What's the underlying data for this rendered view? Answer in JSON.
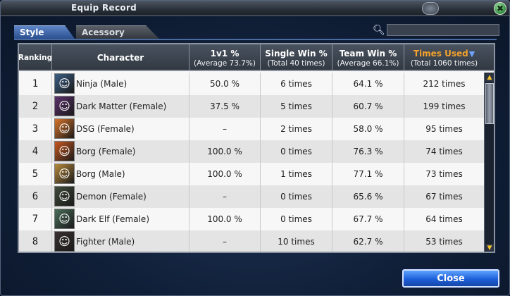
{
  "window": {
    "title": "Equip Record",
    "close_glyph": "✖"
  },
  "tabs": [
    {
      "label": "Style",
      "active": true
    },
    {
      "label": "Acessory",
      "active": false
    }
  ],
  "search": {
    "icon": "search-icon",
    "value": ""
  },
  "table": {
    "headers": {
      "ranking": "Ranking",
      "character": "Character",
      "v1": {
        "title": "1v1 %",
        "sub": "(Average 73.7%)"
      },
      "single": {
        "title": "Single Win %",
        "sub": "(Total 40 times)"
      },
      "team": {
        "title": "Team Win %",
        "sub": "(Average 66.1%)"
      },
      "times": {
        "title": "Times Used",
        "sub": "(Total 1060 times)"
      }
    },
    "sorted_column": "times",
    "rows": [
      {
        "rank": "1",
        "character": "Ninja (Male)",
        "v1": "50.0 %",
        "single": "6 times",
        "team": "64.1 %",
        "times": "212 times",
        "avatar_color": "#3b5f86",
        "avatar_icon": "ninja-portrait-icon"
      },
      {
        "rank": "2",
        "character": "Dark Matter (Female)",
        "v1": "37.5 %",
        "single": "5 times",
        "team": "60.7 %",
        "times": "199 times",
        "avatar_color": "#5b2f6b",
        "avatar_icon": "dark-matter-portrait-icon"
      },
      {
        "rank": "3",
        "character": "DSG (Female)",
        "v1": "–",
        "single": "2 times",
        "team": "58.0 %",
        "times": "95 times",
        "avatar_color": "#d9742a",
        "avatar_icon": "dsg-portrait-icon"
      },
      {
        "rank": "4",
        "character": "Borg (Female)",
        "v1": "100.0 %",
        "single": "0 times",
        "team": "76.3 %",
        "times": "74 times",
        "avatar_color": "#c8581f",
        "avatar_icon": "borg-female-portrait-icon"
      },
      {
        "rank": "5",
        "character": "Borg (Male)",
        "v1": "100.0 %",
        "single": "1 times",
        "team": "77.1 %",
        "times": "73 times",
        "avatar_color": "#b78a3c",
        "avatar_icon": "borg-male-portrait-icon"
      },
      {
        "rank": "6",
        "character": "Demon (Female)",
        "v1": "–",
        "single": "0 times",
        "team": "65.6 %",
        "times": "67 times",
        "avatar_color": "#3f4a3a",
        "avatar_icon": "demon-portrait-icon"
      },
      {
        "rank": "7",
        "character": "Dark Elf (Female)",
        "v1": "100.0 %",
        "single": "0 times",
        "team": "67.7 %",
        "times": "64 times",
        "avatar_color": "#4b6e5a",
        "avatar_icon": "dark-elf-portrait-icon"
      },
      {
        "rank": "8",
        "character": "Fighter (Male)",
        "v1": "–",
        "single": "10 times",
        "team": "62.7 %",
        "times": "53 times",
        "avatar_color": "#3a3030",
        "avatar_icon": "fighter-portrait-icon"
      }
    ]
  },
  "footer": {
    "close_label": "Close"
  }
}
